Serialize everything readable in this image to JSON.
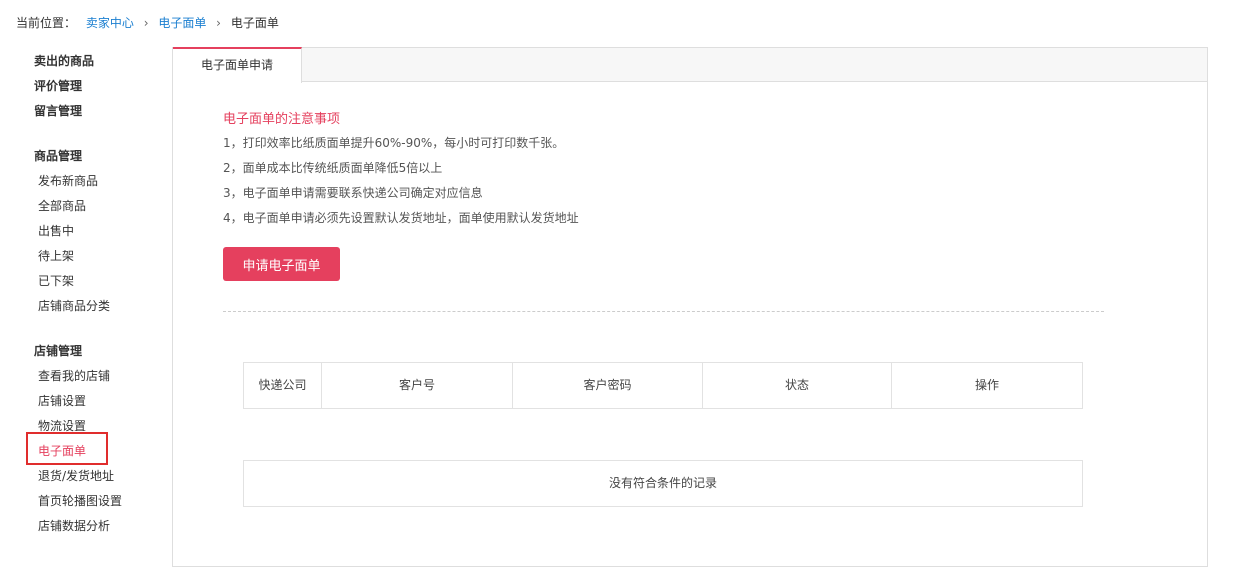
{
  "breadcrumb": {
    "prefix": "当前位置：",
    "items": [
      "卖家中心",
      "电子面单",
      "电子面单"
    ]
  },
  "sidebar": {
    "sections": [
      {
        "heading": "卖出的商品"
      },
      {
        "heading": "评价管理"
      },
      {
        "heading": "留言管理"
      },
      {
        "heading": "商品管理",
        "items": [
          "发布新商品",
          "全部商品",
          "出售中",
          "待上架",
          "已下架",
          "店铺商品分类"
        ]
      },
      {
        "heading": "店铺管理",
        "items": [
          "查看我的店铺",
          "店铺设置",
          "物流设置",
          "电子面单",
          "退货/发货地址",
          "首页轮播图设置",
          "店铺数据分析"
        ]
      }
    ],
    "active_item": "电子面单"
  },
  "tabs": [
    {
      "label": "电子面单申请",
      "active": true
    }
  ],
  "notice": {
    "title": "电子面单的注意事项",
    "lines": [
      "1，打印效率比纸质面单提升60%-90%，每小时可打印数千张。",
      "2，面单成本比传统纸质面单降低5倍以上",
      "3，电子面单申请需要联系快递公司确定对应信息",
      "4，电子面单申请必须先设置默认发货地址，面单使用默认发货地址"
    ]
  },
  "apply_button": "申请电子面单",
  "table": {
    "columns": [
      "快递公司",
      "客户号",
      "客户密码",
      "状态",
      "操作"
    ],
    "empty_text": "没有符合条件的记录"
  },
  "colors": {
    "accent": "#e5405e",
    "link": "#1b7fd0",
    "highlight_box": "#e02d2d"
  }
}
